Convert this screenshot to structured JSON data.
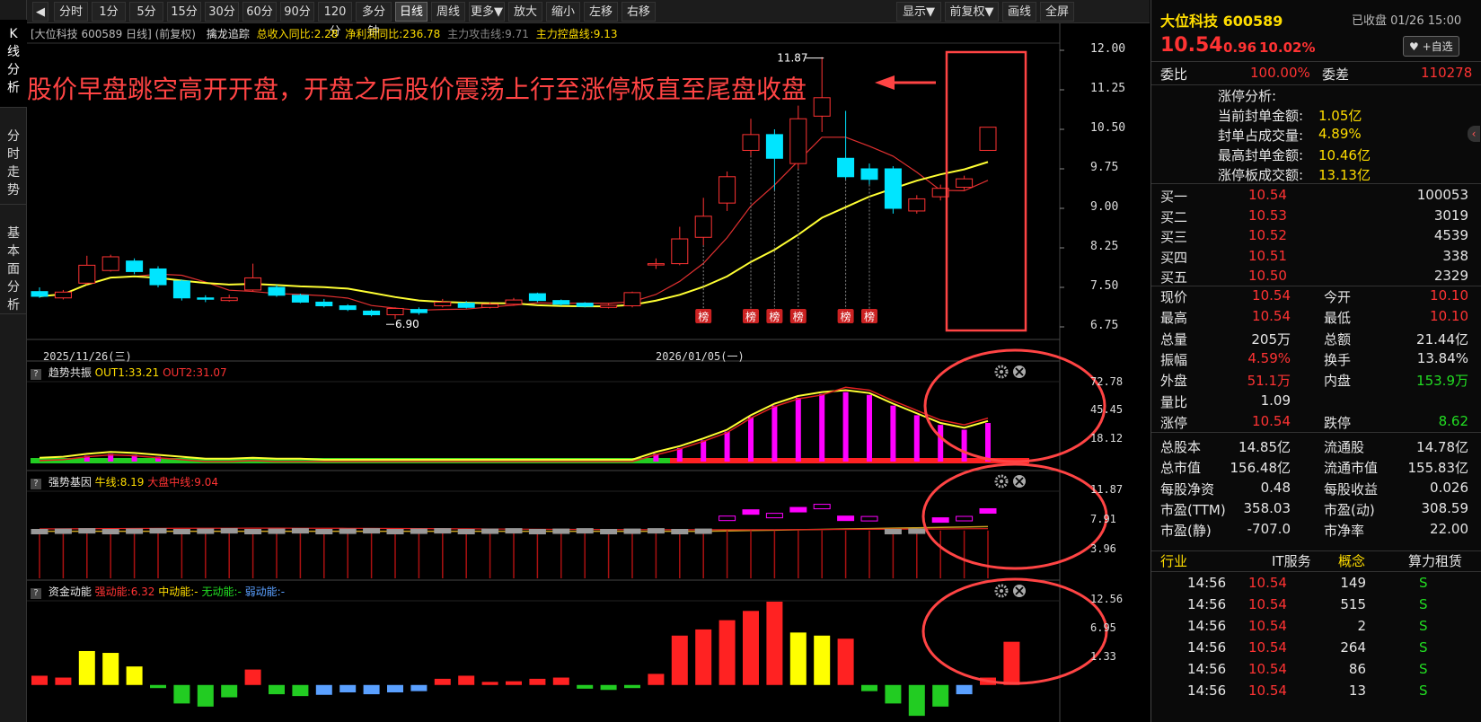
{
  "left_tabs": [
    "K线分析",
    "分时走势",
    "基本面分析"
  ],
  "toolbar": {
    "back_label": "◀",
    "periods": [
      "分时",
      "1分",
      "5分",
      "15分",
      "30分",
      "60分",
      "90分",
      "120分",
      "多分钟",
      "日线",
      "周线",
      "更多▼",
      "放大",
      "缩小",
      "左移",
      "右移"
    ],
    "active_period": "日线",
    "right_buttons": [
      "显示▼",
      "前复权▼",
      "画线",
      "全屏"
    ]
  },
  "main_panel": {
    "info": "[大位科技 600589 日线] (前复权)",
    "indicator": "擒龙追踪",
    "stat1": "总收入同比:2.28",
    "stat2": "净利润同比:236.78",
    "stat3": "主力攻击线:9.71",
    "stat4": "主力控盘线:9.13",
    "annotation": "股价早盘跳空高开开盘，开盘之后股价震荡上行至涨停板直至尾盘收盘",
    "high_label": "11.87",
    "low_label": "6.90",
    "date_left": "2025/11/26(三)",
    "date_mid": "2026/01/05(一)",
    "bang_label": "榜",
    "y_labels": [
      "12.00",
      "11.25",
      "10.50",
      "9.75",
      "9.00",
      "8.25",
      "7.50",
      "6.75"
    ]
  },
  "panel2": {
    "name": "趋势共振",
    "out1": "OUT1:33.21",
    "out2": "OUT2:31.07",
    "y_labels": [
      "72.78",
      "45.45",
      "18.12"
    ]
  },
  "panel3": {
    "name": "强势基因",
    "l1": "牛线:8.19",
    "l2": "大盘中线:9.04",
    "y_labels": [
      "11.87",
      "7.91",
      "3.96"
    ]
  },
  "panel4": {
    "name": "资金动能",
    "l1": "强动能:6.32",
    "l2": "中动能:-",
    "l3": "无动能:-",
    "l4": "弱动能:-",
    "y_labels": [
      "12.56",
      "6.95",
      "1.33"
    ]
  },
  "quote": {
    "name": "大位科技 600589",
    "status": "已收盘 01/26 15:00",
    "price": "10.54",
    "change": "0.96",
    "pct": "10.02%",
    "add_btn": "♥ +自选",
    "weibi_label": "委比",
    "weibi": "100.00%",
    "weicha_label": "委差",
    "weicha": "110278",
    "limit_title": "涨停分析:",
    "limit_rows": [
      {
        "k": "当前封单金额:",
        "v": "1.05亿"
      },
      {
        "k": "封单占成交量:",
        "v": "4.89%"
      },
      {
        "k": "最高封单金额:",
        "v": "10.46亿"
      },
      {
        "k": "涨停板成交额:",
        "v": "13.13亿"
      }
    ],
    "bids": [
      {
        "k": "买一",
        "p": "10.54",
        "v": "100053"
      },
      {
        "k": "买二",
        "p": "10.53",
        "v": "3019"
      },
      {
        "k": "买三",
        "p": "10.52",
        "v": "4539"
      },
      {
        "k": "买四",
        "p": "10.51",
        "v": "338"
      },
      {
        "k": "买五",
        "p": "10.50",
        "v": "2329"
      }
    ],
    "stats": [
      {
        "k1": "现价",
        "v1": "10.54",
        "c1": "red",
        "k2": "今开",
        "v2": "10.10",
        "c2": "red"
      },
      {
        "k1": "最高",
        "v1": "10.54",
        "c1": "red",
        "k2": "最低",
        "v2": "10.10",
        "c2": "red"
      },
      {
        "k1": "总量",
        "v1": "205万",
        "c1": "wht",
        "k2": "总额",
        "v2": "21.44亿",
        "c2": "wht"
      },
      {
        "k1": "振幅",
        "v1": "4.59%",
        "c1": "red",
        "k2": "换手",
        "v2": "13.84%",
        "c2": "wht"
      },
      {
        "k1": "外盘",
        "v1": "51.1万",
        "c1": "red",
        "k2": "内盘",
        "v2": "153.9万",
        "c2": "grn"
      },
      {
        "k1": "量比",
        "v1": "1.09",
        "c1": "wht",
        "k2": "",
        "v2": "",
        "c2": "wht"
      },
      {
        "k1": "涨停",
        "v1": "10.54",
        "c1": "red",
        "k2": "跌停",
        "v2": "8.62",
        "c2": "grn"
      },
      {
        "k1": "总股本",
        "v1": "14.85亿",
        "c1": "wht",
        "k2": "流通股",
        "v2": "14.78亿",
        "c2": "wht"
      },
      {
        "k1": "总市值",
        "v1": "156.48亿",
        "c1": "wht",
        "k2": "流通市值",
        "v2": "155.83亿",
        "c2": "wht"
      },
      {
        "k1": "每股净资",
        "v1": "0.48",
        "c1": "wht",
        "k2": "每股收益",
        "v2": "0.026",
        "c2": "wht"
      },
      {
        "k1": "市盈(TTM)",
        "v1": "358.03",
        "c1": "wht",
        "k2": "市盈(动)",
        "v2": "308.59",
        "c2": "wht"
      },
      {
        "k1": "市盈(静)",
        "v1": "-707.0",
        "c1": "wht",
        "k2": "市净率",
        "v2": "22.00",
        "c2": "wht"
      }
    ],
    "industry_label": "行业",
    "industry": "IT服务",
    "concept_label": "概念",
    "concept": "算力租赁",
    "ticks": [
      {
        "t": "14:56",
        "p": "10.54",
        "v": "149",
        "s": "S"
      },
      {
        "t": "14:56",
        "p": "10.54",
        "v": "515",
        "s": "S"
      },
      {
        "t": "14:56",
        "p": "10.54",
        "v": "2",
        "s": "S"
      },
      {
        "t": "14:56",
        "p": "10.54",
        "v": "264",
        "s": "S"
      },
      {
        "t": "14:56",
        "p": "10.54",
        "v": "86",
        "s": "S"
      },
      {
        "t": "14:56",
        "p": "10.54",
        "v": "13",
        "s": "S"
      }
    ]
  },
  "colors": {
    "up": "#ff3333",
    "down": "#00e5ff",
    "ma1": "#e03030",
    "ma2": "#ffff33",
    "magenta": "#ff00ff",
    "annot": "#ff4444"
  },
  "candles": [
    {
      "o": 7.42,
      "c": 7.33,
      "h": 7.5,
      "l": 7.3
    },
    {
      "o": 7.3,
      "c": 7.41,
      "h": 7.45,
      "l": 7.27
    },
    {
      "o": 7.58,
      "c": 7.92,
      "h": 8.1,
      "l": 7.55
    },
    {
      "o": 7.82,
      "c": 8.08,
      "h": 8.12,
      "l": 7.8
    },
    {
      "o": 8.0,
      "c": 7.8,
      "h": 8.05,
      "l": 7.75
    },
    {
      "o": 7.85,
      "c": 7.55,
      "h": 7.9,
      "l": 7.5
    },
    {
      "o": 7.62,
      "c": 7.3,
      "h": 7.65,
      "l": 7.25
    },
    {
      "o": 7.3,
      "c": 7.28,
      "h": 7.35,
      "l": 7.22
    },
    {
      "o": 7.25,
      "c": 7.3,
      "h": 7.36,
      "l": 7.23
    },
    {
      "o": 7.45,
      "c": 7.68,
      "h": 7.95,
      "l": 7.42
    },
    {
      "o": 7.5,
      "c": 7.35,
      "h": 7.55,
      "l": 7.32
    },
    {
      "o": 7.35,
      "c": 7.22,
      "h": 7.38,
      "l": 7.2
    },
    {
      "o": 7.22,
      "c": 7.15,
      "h": 7.28,
      "l": 7.12
    },
    {
      "o": 7.15,
      "c": 7.08,
      "h": 7.18,
      "l": 7.05
    },
    {
      "o": 7.05,
      "c": 6.98,
      "h": 7.08,
      "l": 6.95
    },
    {
      "o": 6.98,
      "c": 7.1,
      "h": 7.12,
      "l": 6.9
    },
    {
      "o": 7.08,
      "c": 7.02,
      "h": 7.12,
      "l": 6.98
    },
    {
      "o": 7.15,
      "c": 7.22,
      "h": 7.28,
      "l": 7.12
    },
    {
      "o": 7.2,
      "c": 7.12,
      "h": 7.24,
      "l": 7.1
    },
    {
      "o": 7.12,
      "c": 7.18,
      "h": 7.22,
      "l": 7.1
    },
    {
      "o": 7.18,
      "c": 7.26,
      "h": 7.3,
      "l": 7.15
    },
    {
      "o": 7.38,
      "c": 7.25,
      "h": 7.4,
      "l": 7.22
    },
    {
      "o": 7.25,
      "c": 7.18,
      "h": 7.27,
      "l": 7.15
    },
    {
      "o": 7.2,
      "c": 7.14,
      "h": 7.22,
      "l": 7.12
    },
    {
      "o": 7.12,
      "c": 7.16,
      "h": 7.2,
      "l": 7.1
    },
    {
      "o": 7.15,
      "c": 7.4,
      "h": 7.42,
      "l": 7.12
    },
    {
      "o": 7.95,
      "c": 7.95,
      "h": 8.05,
      "l": 7.85
    },
    {
      "o": 7.95,
      "c": 8.42,
      "h": 8.65,
      "l": 7.92
    },
    {
      "o": 8.45,
      "c": 8.85,
      "h": 9.2,
      "l": 8.3
    },
    {
      "o": 9.1,
      "c": 9.6,
      "h": 9.7,
      "l": 8.95
    },
    {
      "o": 10.1,
      "c": 10.4,
      "h": 10.7,
      "l": 10.0
    },
    {
      "o": 10.4,
      "c": 9.95,
      "h": 10.5,
      "l": 9.35
    },
    {
      "o": 9.85,
      "c": 10.7,
      "h": 10.95,
      "l": 9.75
    },
    {
      "o": 10.75,
      "c": 11.1,
      "h": 11.87,
      "l": 10.45
    },
    {
      "o": 9.95,
      "c": 9.6,
      "h": 10.85,
      "l": 9.55
    },
    {
      "o": 9.75,
      "c": 9.55,
      "h": 9.85,
      "l": 9.45
    },
    {
      "o": 9.75,
      "c": 9.0,
      "h": 9.8,
      "l": 8.9
    },
    {
      "o": 8.95,
      "c": 9.18,
      "h": 9.25,
      "l": 8.9
    },
    {
      "o": 9.22,
      "c": 9.38,
      "h": 9.45,
      "l": 9.15
    },
    {
      "o": 9.4,
      "c": 9.56,
      "h": 9.62,
      "l": 9.35
    },
    {
      "o": 10.1,
      "c": 10.54,
      "h": 10.54,
      "l": 10.1
    }
  ],
  "panel2_bars": [
    2,
    3,
    6,
    8,
    7,
    5,
    3,
    1,
    1,
    2,
    1,
    1,
    0,
    0,
    0,
    0,
    0,
    0,
    0,
    0,
    0,
    0,
    0,
    0,
    0,
    0,
    8,
    14,
    22,
    31,
    46,
    58,
    66,
    70,
    72,
    69,
    58,
    48,
    38,
    33,
    40
  ],
  "panel4_bars": [
    1.5,
    1.2,
    5.5,
    5.2,
    3,
    -0.5,
    -3,
    -3.5,
    -2,
    2.5,
    -1.5,
    -1.8,
    -1.6,
    -1.2,
    -1.5,
    -1.2,
    -1,
    1,
    1.5,
    0.5,
    0.6,
    1,
    1.2,
    -0.6,
    -0.8,
    -0.5,
    1.8,
    8,
    9,
    10.5,
    12,
    13.5,
    8.5,
    8,
    7.5,
    -1,
    -3,
    -5,
    -3.5,
    -1.5,
    1.2,
    7
  ]
}
